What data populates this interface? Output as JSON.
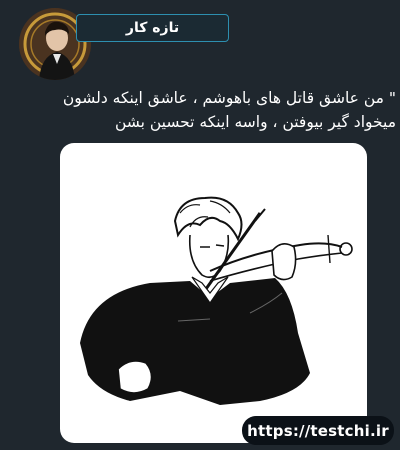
{
  "badge": {
    "label": "تازه کار"
  },
  "tweet": {
    "line1": "\" من عاشق قاتل های باهوشم ، عاشق اینکه دلشون",
    "line2": "میخواد گیر بیوفتن ، واسه اینکه تحسین بشن"
  },
  "image": {
    "icon": "violinist-sketch"
  },
  "avatar": {
    "icon": "profile-avatar"
  },
  "watermark": {
    "text": "https://testchi.ir"
  },
  "colors": {
    "background": "#1f272e",
    "badge_border": "#2d8fb0",
    "card": "#ffffff"
  }
}
